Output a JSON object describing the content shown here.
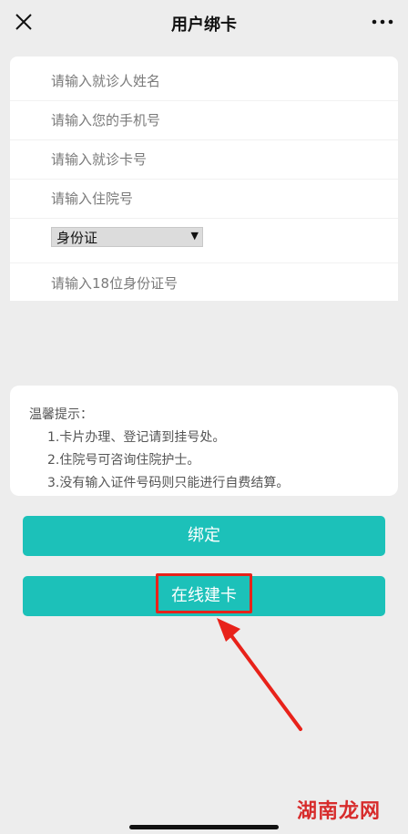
{
  "header": {
    "title": "用户绑卡",
    "close_icon": "close-icon",
    "more_icon": "more-icon"
  },
  "form": {
    "name_placeholder": "请输入就诊人姓名",
    "phone_placeholder": "请输入您的手机号",
    "card_placeholder": "请输入就诊卡号",
    "hospital_no_placeholder": "请输入住院号",
    "id_type_value": "身份证",
    "id_number_placeholder": "请输入18位身份证号"
  },
  "tips": {
    "title": "温馨提示：",
    "items": [
      "1.卡片办理、登记请到挂号处。",
      "2.住院号可咨询住院护士。",
      "3.没有输入证件号码则只能进行自费结算。"
    ]
  },
  "actions": {
    "bind_label": "绑定",
    "create_label": "在线建卡"
  },
  "watermark": "湖南龙网",
  "colors": {
    "accent": "#1cc1b9",
    "highlight": "#e8221a",
    "background": "#ededed"
  }
}
